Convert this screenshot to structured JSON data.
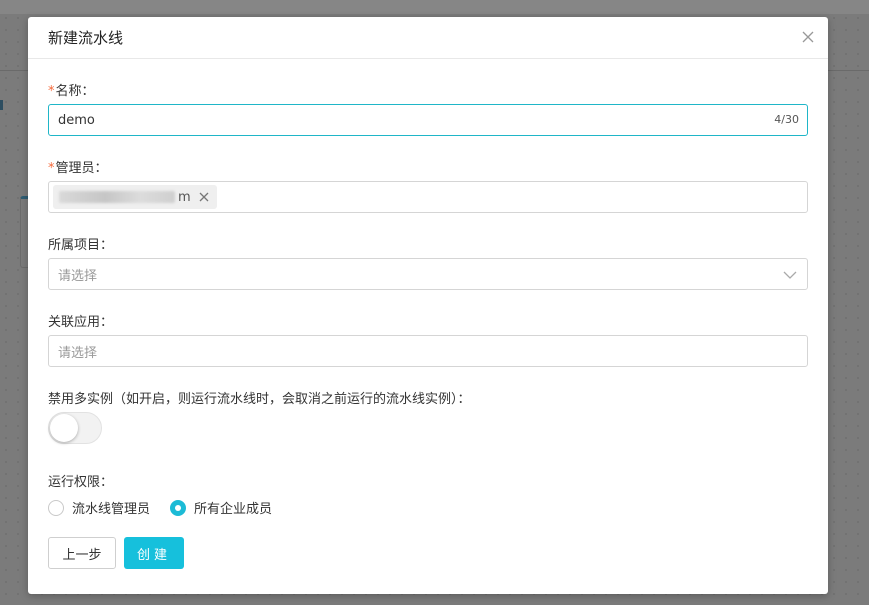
{
  "modal": {
    "title": "新建流水线",
    "close_icon": "close-icon"
  },
  "form": {
    "name": {
      "required_mark": "*",
      "label": "名称：",
      "value": "demo",
      "counter": "4/30"
    },
    "admin": {
      "required_mark": "*",
      "label": "管理员：",
      "tag_suffix": "m"
    },
    "project": {
      "label": "所属项目：",
      "placeholder": "请选择"
    },
    "app": {
      "label": "关联应用：",
      "placeholder": "请选择"
    },
    "disable_multi": {
      "label": "禁用多实例（如开启，则运行流水线时，会取消之前运行的流水线实例）：",
      "enabled": false
    },
    "run_permission": {
      "label": "运行权限：",
      "options": [
        {
          "label": "流水线管理员",
          "checked": false
        },
        {
          "label": "所有企业成员",
          "checked": true
        }
      ]
    }
  },
  "buttons": {
    "prev": "上一步",
    "create": "创建"
  },
  "colors": {
    "accent": "#16c0dc",
    "focus_border": "#1fb6c8",
    "required": "#f5693a"
  }
}
